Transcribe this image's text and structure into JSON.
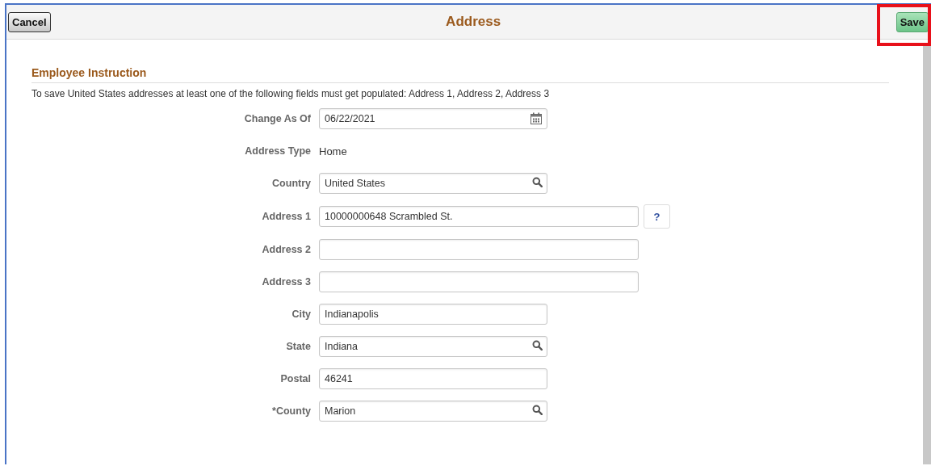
{
  "header": {
    "title": "Address",
    "cancel_button": "Cancel",
    "save_button": "Save",
    "save_highlighted": true
  },
  "section": {
    "title": "Employee Instruction",
    "instruction": "To save United States addresses at least one of the following fields must get populated: Address 1, Address 2, Address 3"
  },
  "fields": [
    {
      "label": "Change As Of",
      "kind": "date",
      "value": "06/22/2021"
    },
    {
      "label": "Address Type",
      "kind": "static",
      "value": "Home"
    },
    {
      "label": "Country",
      "kind": "lookup",
      "value": "United States"
    },
    {
      "label": "Address 1",
      "kind": "long",
      "value": "10000000648 Scrambled St.",
      "help": "?"
    },
    {
      "label": "Address 2",
      "kind": "long"
    },
    {
      "label": "Address 3",
      "kind": "long"
    },
    {
      "label": "City",
      "kind": "text",
      "value": "Indianapolis"
    },
    {
      "label": "State",
      "kind": "lookup",
      "value": "Indiana"
    },
    {
      "label": "Postal",
      "kind": "text",
      "value": "46241"
    },
    {
      "label": "*County",
      "kind": "lookup",
      "value": "Marion"
    }
  ]
}
